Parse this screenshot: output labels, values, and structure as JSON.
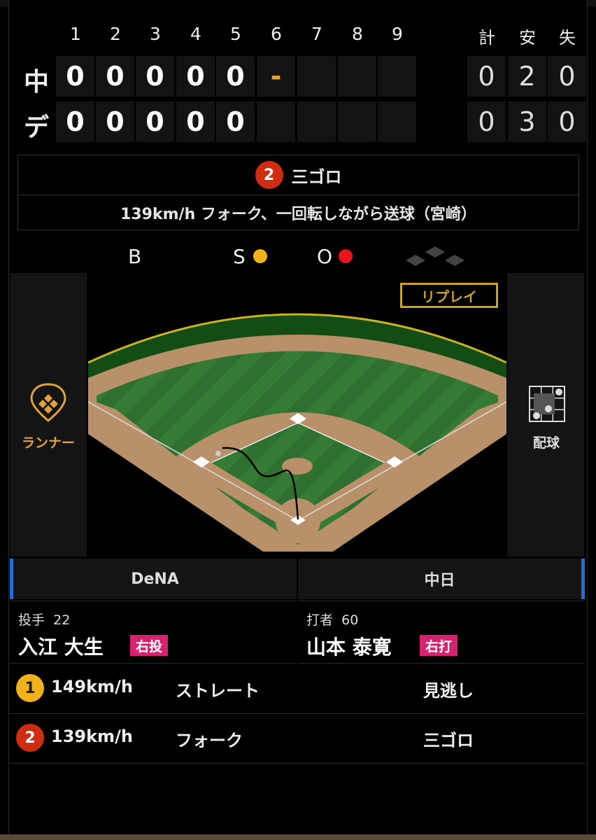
{
  "innings": [
    "1",
    "2",
    "3",
    "4",
    "5",
    "6",
    "7",
    "8",
    "9"
  ],
  "rhe_headers": [
    "計",
    "安",
    "失"
  ],
  "teams": [
    {
      "abbr": "中",
      "scores": [
        "0",
        "0",
        "0",
        "0",
        "0",
        "-",
        "",
        "",
        ""
      ],
      "rhe": [
        "0",
        "2",
        "0"
      ]
    },
    {
      "abbr": "デ",
      "scores": [
        "0",
        "0",
        "0",
        "0",
        "0",
        "",
        "",
        "",
        ""
      ],
      "rhe": [
        "0",
        "3",
        "0"
      ]
    }
  ],
  "play": {
    "pitch_no": "2",
    "result": "三ゴロ",
    "detail": "139km/h フォーク、一回転しながら送球（宮崎）"
  },
  "count": {
    "b_label": "B",
    "s_label": "S",
    "o_label": "O",
    "balls": 0,
    "strikes": 1,
    "outs": 1,
    "strike_color": "#f2b31a",
    "out_color": "#e8141c"
  },
  "field": {
    "replay_label": "リプレイ"
  },
  "side": {
    "runner_label": "ランナー",
    "pitch_chart_label": "配球",
    "runner_color": "#e0a23a"
  },
  "tabs": {
    "home": "DeNA",
    "away": "中日"
  },
  "pitcher": {
    "role": "投手",
    "number": "22",
    "name": "入江 大生",
    "hand": "右投"
  },
  "batter": {
    "role": "打者",
    "number": "60",
    "name": "山本 泰寛",
    "hand": "右打"
  },
  "pitches": [
    {
      "no": "1",
      "speed": "149km/h",
      "type": "ストレート",
      "result": "見逃し",
      "color": "yellow"
    },
    {
      "no": "2",
      "speed": "139km/h",
      "type": "フォーク",
      "result": "三ゴロ",
      "color": "red"
    }
  ]
}
